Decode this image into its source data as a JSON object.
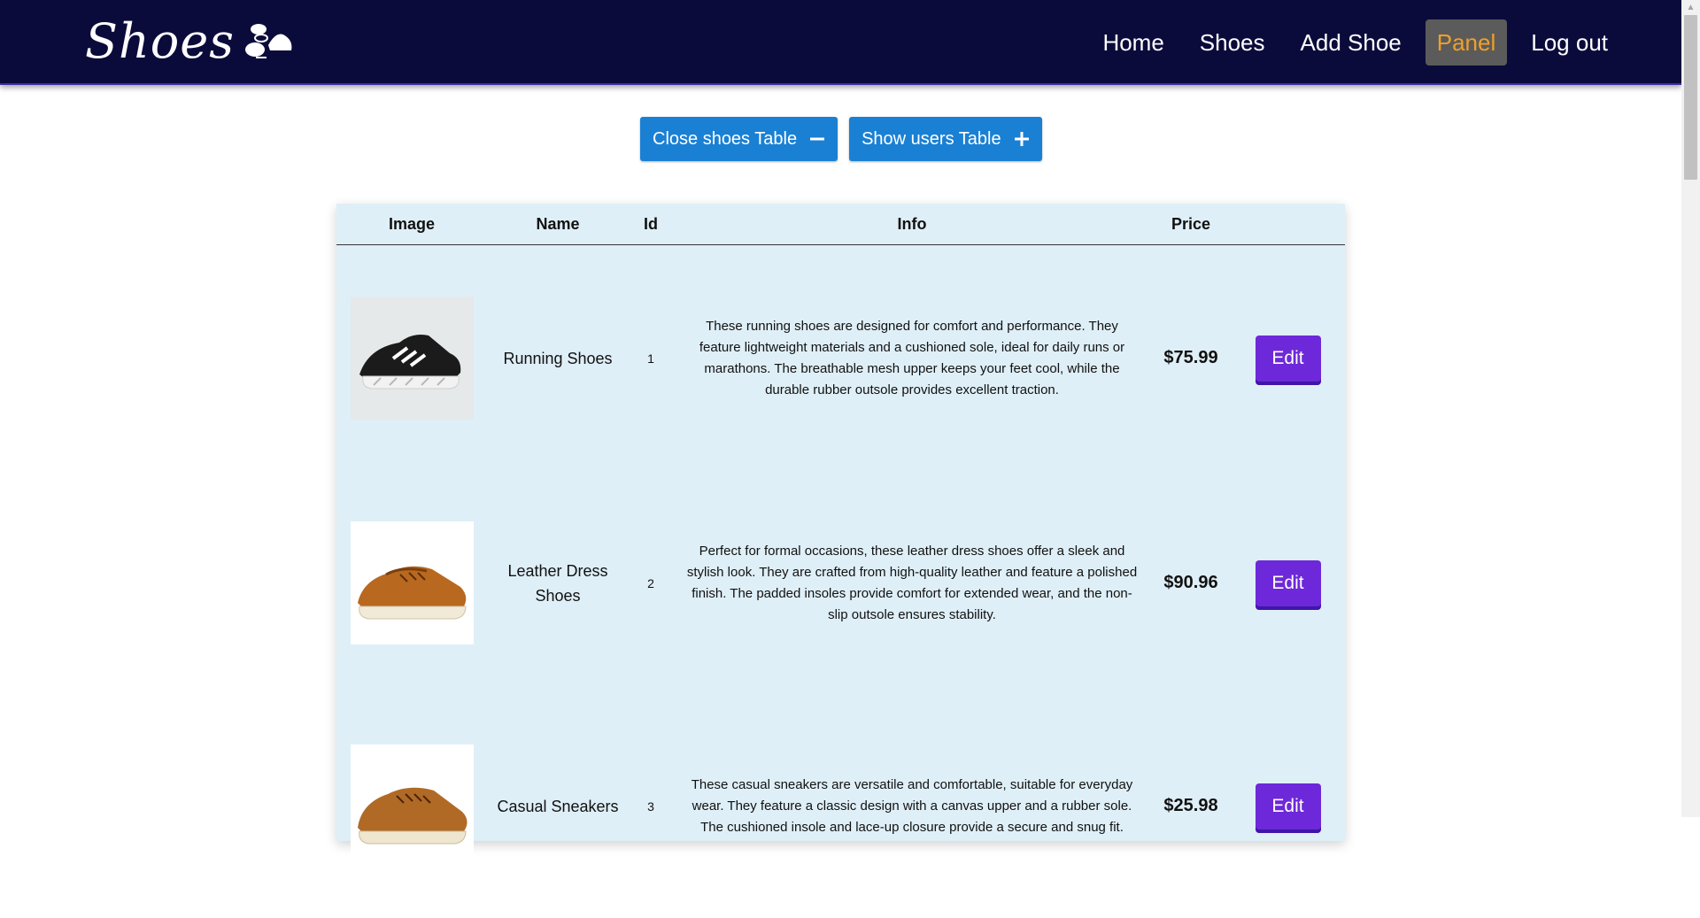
{
  "brand": {
    "name": "Shoes"
  },
  "nav": {
    "items": [
      {
        "label": "Home",
        "active": false
      },
      {
        "label": "Shoes",
        "active": false
      },
      {
        "label": "Add Shoe",
        "active": false
      },
      {
        "label": "Panel",
        "active": true
      },
      {
        "label": "Log out",
        "active": false
      }
    ]
  },
  "toggles": {
    "close_shoes": {
      "label": "Close shoes Table",
      "icon": "minus-icon"
    },
    "show_users": {
      "label": "Show users Table",
      "icon": "plus-icon"
    }
  },
  "table": {
    "columns": [
      "Image",
      "Name",
      "Id",
      "Info",
      "Price",
      ""
    ],
    "rows": [
      {
        "image": "running-shoe-image",
        "name": "Running Shoes",
        "id": "1",
        "info": "These running shoes are designed for comfort and performance. They feature lightweight materials and a cushioned sole, ideal for daily runs or marathons. The breathable mesh upper keeps your feet cool, while the durable rubber outsole provides excellent traction.",
        "price": "$75.99",
        "action": "Edit"
      },
      {
        "image": "leather-dress-shoe-image",
        "name": "Leather Dress Shoes",
        "id": "2",
        "info": "Perfect for formal occasions, these leather dress shoes offer a sleek and stylish look. They are crafted from high-quality leather and feature a polished finish. The padded insoles provide comfort for extended wear, and the non-slip outsole ensures stability.",
        "price": "$90.96",
        "action": "Edit"
      },
      {
        "image": "casual-sneaker-image",
        "name": "Casual Sneakers",
        "id": "3",
        "info": "These casual sneakers are versatile and comfortable, suitable for everyday wear. They feature a classic design with a canvas upper and a rubber sole. The cushioned insole and lace-up closure provide a secure and snug fit.",
        "price": "$25.98",
        "action": "Edit"
      }
    ]
  },
  "colors": {
    "navbar": "#0b0b3b",
    "active_nav": "#f0a028",
    "toggle_button": "#1a80d4",
    "edit_button": "#6d28d9",
    "table_bg": "#dfeff7"
  }
}
